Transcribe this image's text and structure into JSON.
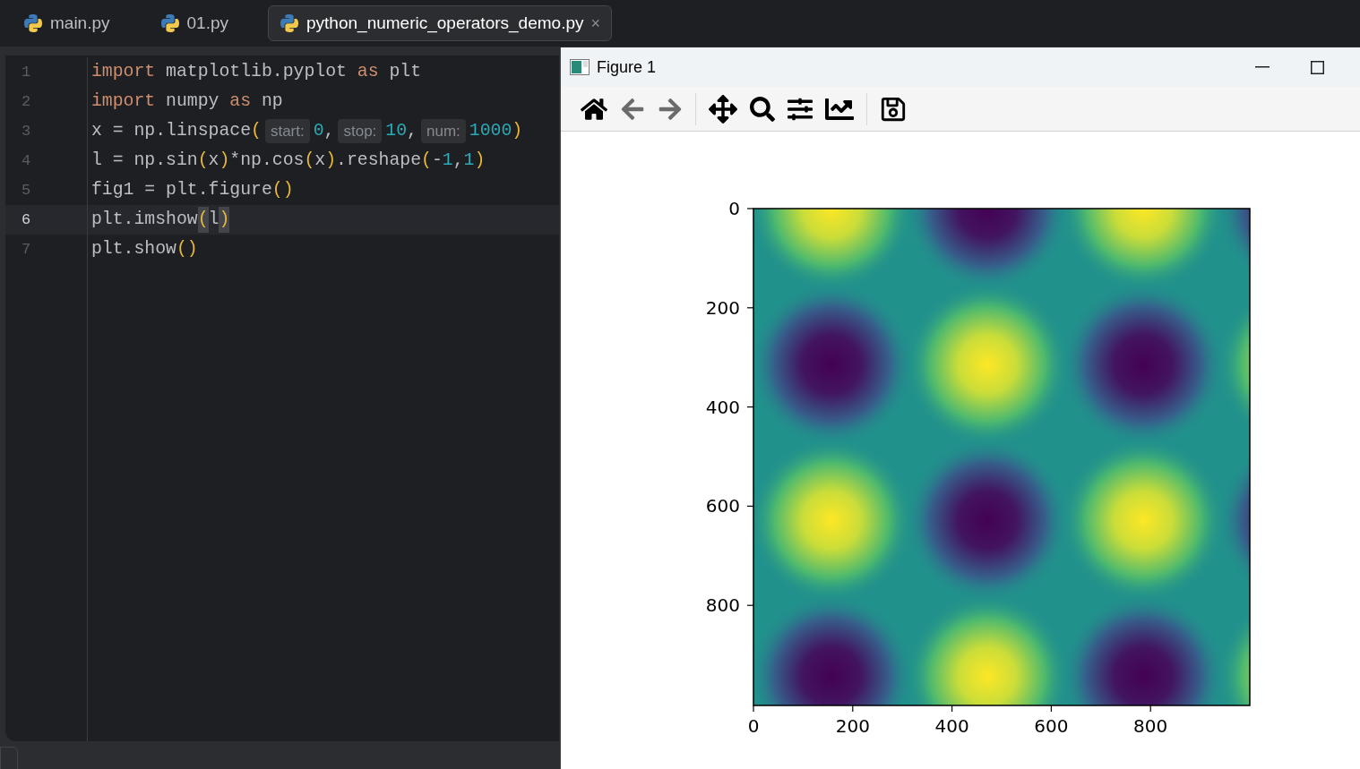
{
  "tabs": [
    {
      "label": "main.py",
      "selected": false
    },
    {
      "label": "01.py",
      "selected": false
    },
    {
      "label": "python_numeric_operators_demo.py",
      "selected": true,
      "close": "×"
    }
  ],
  "editor": {
    "lines": [
      {
        "number": "1",
        "current": false,
        "tokens": [
          {
            "kind": "keyword",
            "text": "import"
          },
          {
            "kind": "plain",
            "text": " matplotlib.pyplot "
          },
          {
            "kind": "keyword",
            "text": "as"
          },
          {
            "kind": "plain",
            "text": " plt"
          }
        ]
      },
      {
        "number": "2",
        "current": false,
        "tokens": [
          {
            "kind": "keyword",
            "text": "import"
          },
          {
            "kind": "plain",
            "text": " numpy "
          },
          {
            "kind": "keyword",
            "text": "as"
          },
          {
            "kind": "plain",
            "text": " np"
          }
        ]
      },
      {
        "number": "3",
        "current": false,
        "tokens": [
          {
            "kind": "plain",
            "text": "x = np.linspace"
          },
          {
            "kind": "paren",
            "text": "("
          },
          {
            "kind": "hint",
            "text": "start:"
          },
          {
            "kind": "number",
            "text": "0"
          },
          {
            "kind": "plain",
            "text": ","
          },
          {
            "kind": "hint",
            "text": "stop:"
          },
          {
            "kind": "number",
            "text": "10"
          },
          {
            "kind": "plain",
            "text": ","
          },
          {
            "kind": "hint",
            "text": "num:"
          },
          {
            "kind": "number",
            "text": "1000"
          },
          {
            "kind": "paren",
            "text": ")"
          }
        ]
      },
      {
        "number": "4",
        "current": false,
        "tokens": [
          {
            "kind": "plain",
            "text": "l = np.sin"
          },
          {
            "kind": "paren",
            "text": "("
          },
          {
            "kind": "plain",
            "text": "x"
          },
          {
            "kind": "paren",
            "text": ")"
          },
          {
            "kind": "plain",
            "text": "*np.cos"
          },
          {
            "kind": "paren",
            "text": "("
          },
          {
            "kind": "plain",
            "text": "x"
          },
          {
            "kind": "paren",
            "text": ")"
          },
          {
            "kind": "plain",
            "text": ".reshape"
          },
          {
            "kind": "paren",
            "text": "("
          },
          {
            "kind": "plain",
            "text": "-"
          },
          {
            "kind": "number",
            "text": "1"
          },
          {
            "kind": "plain",
            "text": ","
          },
          {
            "kind": "number",
            "text": "1"
          },
          {
            "kind": "paren",
            "text": ")"
          }
        ]
      },
      {
        "number": "5",
        "current": false,
        "tokens": [
          {
            "kind": "plain",
            "text": "fig1 = plt.figure"
          },
          {
            "kind": "paren",
            "text": "()"
          }
        ]
      },
      {
        "number": "6",
        "current": true,
        "tokens": [
          {
            "kind": "plain",
            "text": "plt.imshow"
          },
          {
            "kind": "paren_match",
            "text": "("
          },
          {
            "kind": "plain",
            "text": "l"
          },
          {
            "kind": "paren_match",
            "text": ")"
          }
        ]
      },
      {
        "number": "7",
        "current": false,
        "tokens": [
          {
            "kind": "plain",
            "text": "plt.show"
          },
          {
            "kind": "paren",
            "text": "()"
          }
        ]
      }
    ]
  },
  "figure_window": {
    "title": "Figure 1",
    "toolbar": [
      {
        "kind": "home",
        "disabled": false
      },
      {
        "kind": "back",
        "disabled": true
      },
      {
        "kind": "forward",
        "disabled": true
      },
      {
        "kind": "separator"
      },
      {
        "kind": "pan",
        "disabled": false
      },
      {
        "kind": "zoom",
        "disabled": false
      },
      {
        "kind": "subplots",
        "disabled": false
      },
      {
        "kind": "axes",
        "disabled": false
      },
      {
        "kind": "separator"
      },
      {
        "kind": "save",
        "disabled": false
      }
    ],
    "plot": {
      "xticks": [
        "0",
        "200",
        "400",
        "600",
        "800"
      ],
      "yticks": [
        "0",
        "200",
        "400",
        "600",
        "800"
      ]
    }
  }
}
